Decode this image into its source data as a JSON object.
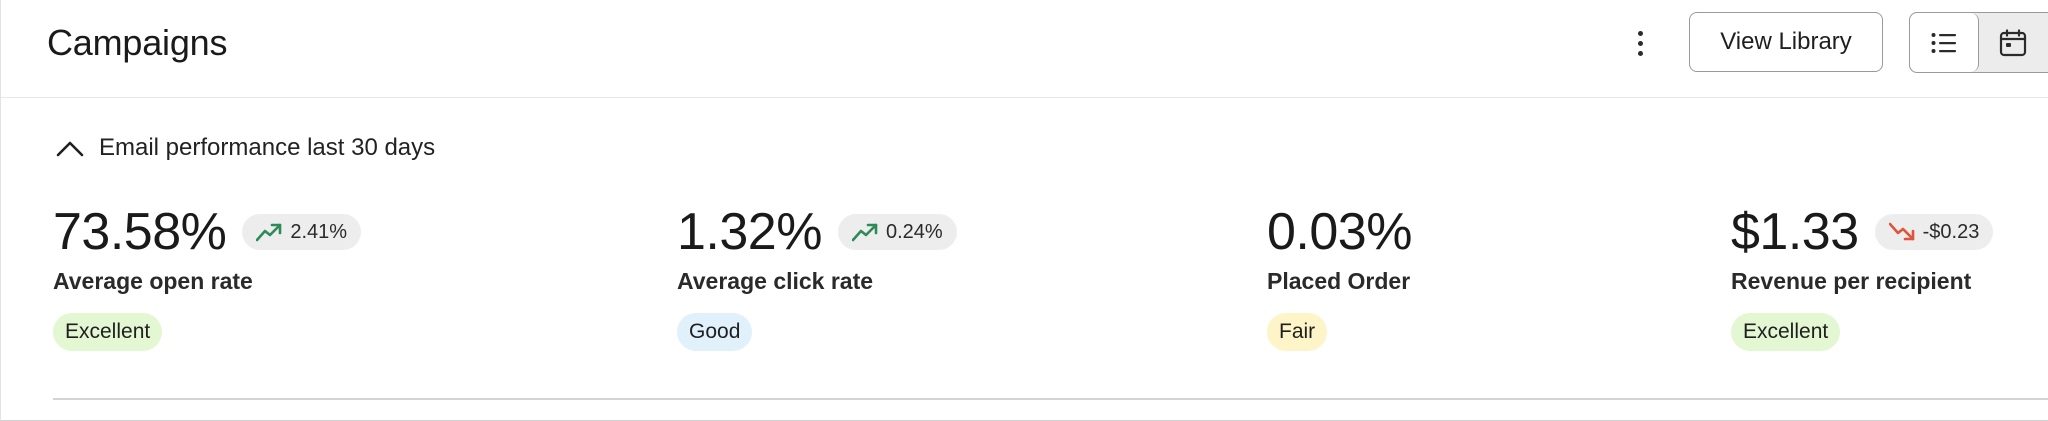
{
  "header": {
    "title": "Campaigns",
    "more_icon": "more-vertical-icon",
    "view_library_label": "View Library",
    "view_toggle": {
      "list_icon": "list-icon",
      "calendar_icon": "calendar-icon",
      "selected": "list"
    }
  },
  "section": {
    "title": "Email performance last 30 days",
    "toggle_icon": "chevron-up-icon",
    "expanded": true
  },
  "colors": {
    "trend_up": "#2e8b57",
    "trend_down": "#e0533d",
    "badge_excellent_bg": "#e3f7d3",
    "badge_good_bg": "#e0f1fb",
    "badge_fair_bg": "#fdf4c7"
  },
  "metrics": [
    {
      "value": "73.58%",
      "trend": {
        "direction": "up",
        "icon": "trend-up-icon",
        "value": "2.41%"
      },
      "label": "Average open rate",
      "rating": "Excellent"
    },
    {
      "value": "1.32%",
      "trend": {
        "direction": "up",
        "icon": "trend-up-icon",
        "value": "0.24%"
      },
      "label": "Average click rate",
      "rating": "Good"
    },
    {
      "value": "0.03%",
      "label": "Placed Order",
      "rating": "Fair"
    },
    {
      "value": "$1.33",
      "trend": {
        "direction": "down",
        "icon": "trend-down-icon",
        "value": "-$0.23"
      },
      "label": "Revenue per recipient",
      "rating": "Excellent"
    }
  ]
}
